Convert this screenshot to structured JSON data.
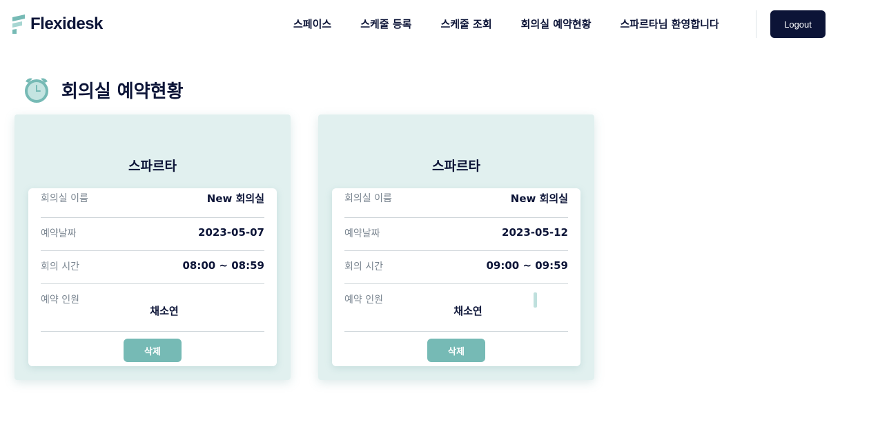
{
  "header": {
    "logo_text": "Flexidesk",
    "nav": [
      "스페이스",
      "스케줄 등록",
      "스케줄 조회",
      "회의실 예약현황",
      "스파르타님 환영합니다"
    ],
    "logout_label": "Logout"
  },
  "page": {
    "title": "회의실 예약현황"
  },
  "labels": {
    "room_name": "회의실 이름",
    "date": "예약날짜",
    "time": "회의 시간",
    "attendees": "예약 인원",
    "delete": "삭제"
  },
  "colors": {
    "navy": "#0c1437",
    "teal": "#76bab5",
    "card_bg": "#e1f0ef"
  },
  "reservations": [
    {
      "title": "스파르타",
      "room_name": "New 회의실",
      "date": "2023-05-07",
      "time": "08:00 ~ 08:59",
      "attendee": "채소연"
    },
    {
      "title": "스파르타",
      "room_name": "New 회의실",
      "date": "2023-05-12",
      "time": "09:00 ~ 09:59",
      "attendee": "채소연"
    }
  ]
}
